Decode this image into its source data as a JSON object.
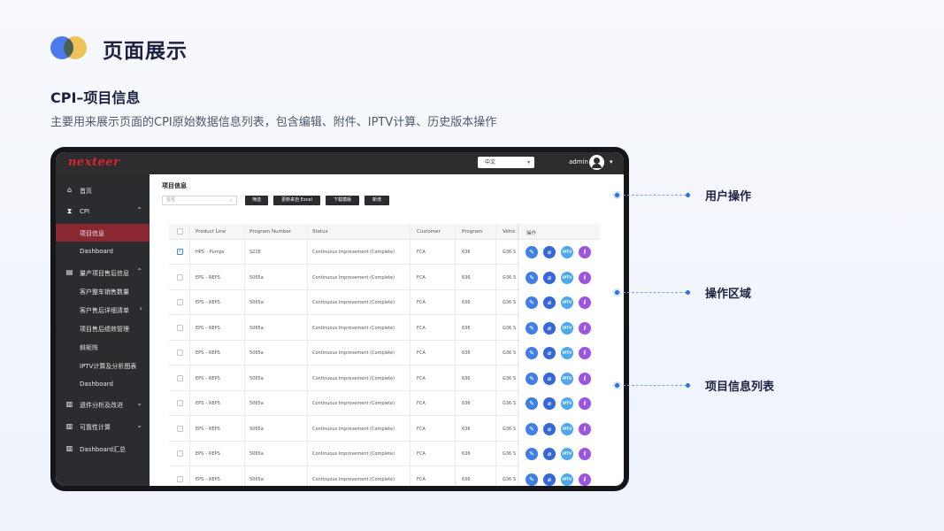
{
  "slide": {
    "title": "页面展示",
    "section_title": "CPI–项目信息",
    "description": "主要用来展示页面的CPI原始数据信息列表，包含编辑、附件、IPTV计算、历史版本操作",
    "colors": {
      "accent_blue": "#4a7cf0",
      "accent_yellow": "#f8c75a",
      "callout": "#2e6fe0"
    }
  },
  "app": {
    "logo": "nexteer",
    "language": "中文",
    "user": "admin",
    "colors": {
      "topbar": "#2d2d30",
      "sidebar": "#2b2c30",
      "active_nav": "#8b2730",
      "logo": "#d9262d"
    }
  },
  "sidebar": {
    "items": [
      {
        "label": "首页",
        "icon": "home-icon"
      },
      {
        "label": "CPI",
        "icon": "hourglass-icon",
        "expanded": true
      },
      {
        "label": "项目信息",
        "active": true
      },
      {
        "label": "Dashboard"
      },
      {
        "label": "量产项目售后信息",
        "icon": "document-icon",
        "expanded": true
      },
      {
        "label": "客户整车销售数量"
      },
      {
        "label": "客户售后详细清单"
      },
      {
        "label": "项目售后绩效管理"
      },
      {
        "label": "斜矩阵"
      },
      {
        "label": "IPTV计算及分析图表"
      },
      {
        "label": "Dashboard"
      },
      {
        "label": "遗件分析及改进",
        "icon": "chart-icon"
      },
      {
        "label": "可靠性计算",
        "icon": "chart-icon"
      },
      {
        "label": "Dashboard汇总",
        "icon": "chart-icon"
      }
    ]
  },
  "main": {
    "page_title": "项目信息",
    "search_placeholder": "框框",
    "buttons": {
      "filter": "筛选",
      "import_excel": "更新来自 Excel",
      "download_template": "下载模版",
      "add": "新增"
    },
    "columns": [
      "Product Line",
      "Program Number",
      "Status",
      "Customer",
      "Program",
      "Vehic",
      "操作"
    ],
    "rows": [
      {
        "checked": true,
        "product_line": "HPS – Pumps",
        "program_number": "S228",
        "status": "Continuous Improvement (Complete)",
        "customer": "FCA",
        "program": "636",
        "vehicle": "G36 S"
      },
      {
        "checked": false,
        "product_line": "EPS – REPS",
        "program_number": "5065a",
        "status": "Continuous Improvement (Complete)",
        "customer": "FCA",
        "program": "636",
        "vehicle": "G36 S"
      },
      {
        "checked": false,
        "product_line": "EPS – REPS",
        "program_number": "5065a",
        "status": "Continuous Improvement (Complete)",
        "customer": "FCA",
        "program": "636",
        "vehicle": "G36 S"
      },
      {
        "checked": false,
        "product_line": "EPS – REPS",
        "program_number": "5065a",
        "status": "Continuous Improvement (Complete)",
        "customer": "FCA",
        "program": "636",
        "vehicle": "G36 S"
      },
      {
        "checked": false,
        "product_line": "EPS – REPS",
        "program_number": "5065a",
        "status": "Continuous Improvement (Complete)",
        "customer": "FCA",
        "program": "636",
        "vehicle": "G36 S"
      },
      {
        "checked": false,
        "product_line": "EPS – REPS",
        "program_number": "5065a",
        "status": "Continuous Improvement (Complete)",
        "customer": "FCA",
        "program": "636",
        "vehicle": "G36 S"
      },
      {
        "checked": false,
        "product_line": "EPS – REPS",
        "program_number": "5065a",
        "status": "Continuous Improvement (Complete)",
        "customer": "FCA",
        "program": "636",
        "vehicle": "G36 S"
      },
      {
        "checked": false,
        "product_line": "EPS – REPS",
        "program_number": "5065a",
        "status": "Continuous Improvement (Complete)",
        "customer": "FCA",
        "program": "636",
        "vehicle": "G36 S"
      },
      {
        "checked": false,
        "product_line": "EPS – REPS",
        "program_number": "5065a",
        "status": "Continuous Improvement (Complete)",
        "customer": "FCA",
        "program": "636",
        "vehicle": "G36 S"
      },
      {
        "checked": false,
        "product_line": "EPS – REPS",
        "program_number": "5065a",
        "status": "Continuous Improvement (Complete)",
        "customer": "FCA",
        "program": "636",
        "vehicle": "G36 S"
      }
    ],
    "row_actions": [
      {
        "name": "edit-icon",
        "label": "✎"
      },
      {
        "name": "attachment-icon",
        "label": "⌀"
      },
      {
        "name": "iptv-icon",
        "label": "IPTV"
      },
      {
        "name": "info-icon",
        "label": "i"
      }
    ]
  },
  "callouts": [
    "用户操作",
    "操作区域",
    "项目信息列表"
  ]
}
